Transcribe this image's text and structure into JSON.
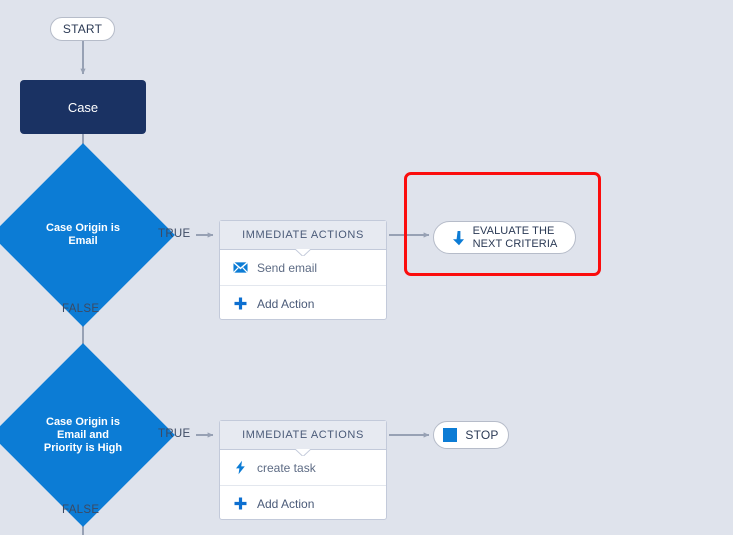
{
  "canvas": {
    "background_color": "#dfe3ec",
    "accent_blue": "#0c7cd5",
    "object_navy": "#1a3263",
    "highlight_red": "#fb0d0d",
    "connector_grey": "#97a1b4"
  },
  "start": {
    "label": "START"
  },
  "object_node": {
    "label": "Case"
  },
  "criteria": [
    {
      "id": "criteria-1",
      "label": "Case Origin  is\nEmail",
      "true_label": "TRUE",
      "false_label": "FALSE",
      "panel": {
        "header": "IMMEDIATE ACTIONS",
        "rows": [
          {
            "icon": "envelope-icon",
            "label": "Send email"
          },
          {
            "icon": "plus-icon",
            "label": "Add Action"
          }
        ]
      },
      "result": {
        "type": "evaluate-next-criteria",
        "icon": "arrow-down-icon",
        "label": "EVALUATE THE NEXT CRITERIA",
        "label_line_1": "EVALUATE THE",
        "label_line_2": "NEXT CRITERIA",
        "highlighted": true
      }
    },
    {
      "id": "criteria-2",
      "label": "Case Origin is\nEmail and\nPriority is High",
      "true_label": "TRUE",
      "false_label": "FALSE",
      "panel": {
        "header": "IMMEDIATE ACTIONS",
        "rows": [
          {
            "icon": "bolt-icon",
            "label": "create task"
          },
          {
            "icon": "plus-icon",
            "label": "Add Action"
          }
        ]
      },
      "result": {
        "type": "stop",
        "icon": "stop-square-icon",
        "label": "STOP",
        "highlighted": false
      }
    }
  ]
}
